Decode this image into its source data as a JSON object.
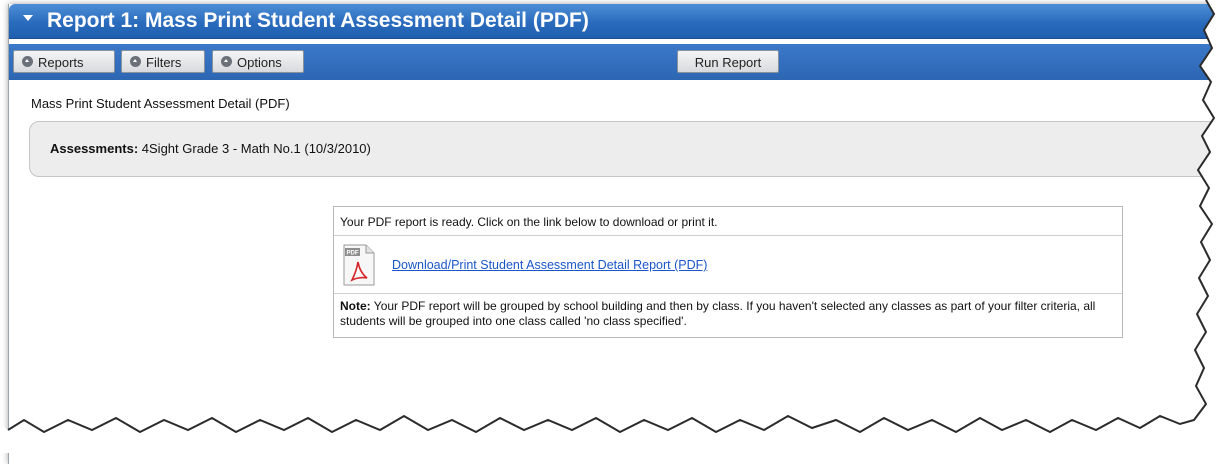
{
  "window": {
    "title": "Report 1: Mass Print Student Assessment Detail (PDF)"
  },
  "toolbar": {
    "reports_label": "Reports",
    "filters_label": "Filters",
    "options_label": "Options",
    "run_label": "Run Report"
  },
  "content": {
    "subtitle": "Mass Print Student Assessment Detail (PDF)",
    "assessments_label": "Assessments:",
    "assessments_value": "4Sight Grade 3 - Math No.1 (10/3/2010)"
  },
  "pdf_panel": {
    "ready_text": "Your PDF report is ready. Click on the link below to download or print it.",
    "icon_text": "PDF",
    "link_text": "Download/Print Student Assessment Detail Report (PDF)",
    "note_label": "Note:",
    "note_text": " Your PDF report will be grouped by school building and then by class. If you haven't selected any classes as part of your filter criteria, all students will be grouped into one class called 'no class specified'."
  },
  "colors": {
    "header_blue": "#2a6bbd",
    "link_blue": "#1a56c9",
    "panel_gray": "#ededed"
  }
}
